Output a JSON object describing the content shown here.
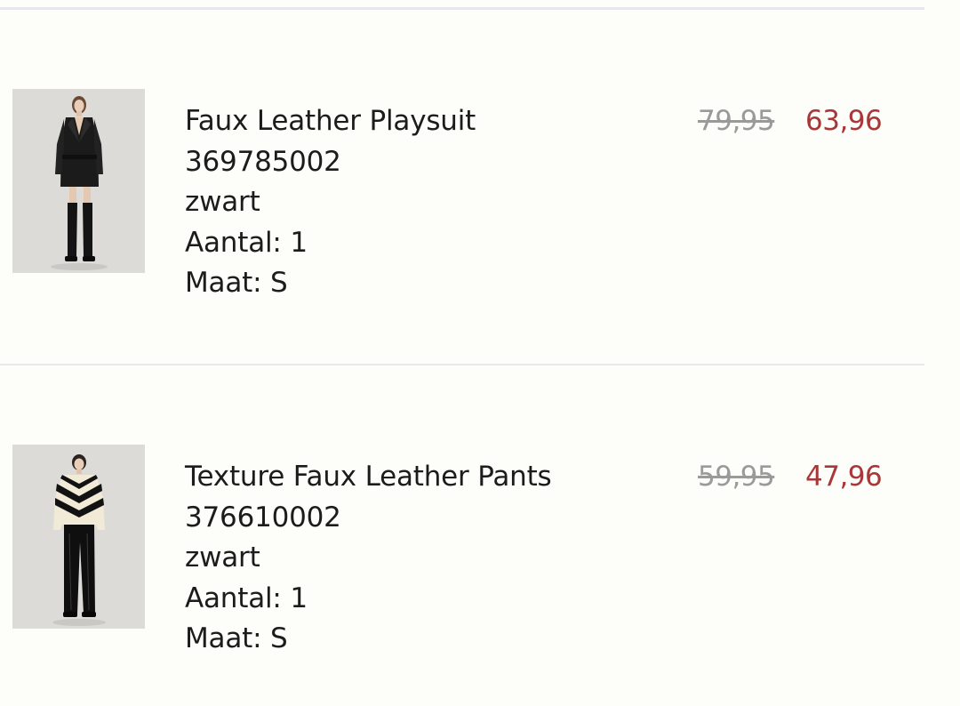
{
  "cart": {
    "items": [
      {
        "name": "Faux Leather Playsuit",
        "article_number": "369785002",
        "color": "zwart",
        "quantity_label": "Aantal:",
        "quantity": "1",
        "size_label": "Maat:",
        "size": "S",
        "old_price": "79,95",
        "price": "63,96",
        "image_icon": "product-photo-playsuit"
      },
      {
        "name": "Texture Faux Leather Pants",
        "article_number": "376610002",
        "color": "zwart",
        "quantity_label": "Aantal:",
        "quantity": "1",
        "size_label": "Maat:",
        "size": "S",
        "old_price": "59,95",
        "price": "47,96",
        "image_icon": "product-photo-pants"
      }
    ]
  },
  "colors": {
    "background": "#fdfdf9",
    "sale_price": "#a8373a",
    "old_price": "#9a9a9a",
    "divider": "#e9e9e9"
  }
}
